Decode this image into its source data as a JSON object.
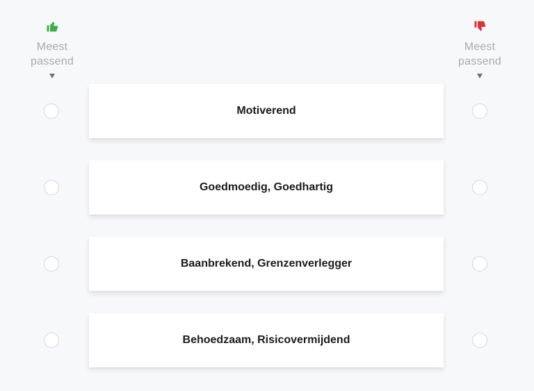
{
  "header": {
    "most_label_line1": "Meest",
    "most_label_line2": "passend",
    "least_label_line1": "Meest",
    "least_label_line2": "passend",
    "most_icon": "thumbs-up-icon",
    "least_icon": "thumbs-down-icon",
    "most_color": "#3bb04a",
    "least_color": "#d9343b"
  },
  "options": [
    {
      "label": "Motiverend",
      "most_selected": false,
      "least_selected": false
    },
    {
      "label": "Goedmoedig, Goedhartig",
      "most_selected": false,
      "least_selected": false
    },
    {
      "label": "Baanbrekend, Grenzenverlegger",
      "most_selected": false,
      "least_selected": false
    },
    {
      "label": "Behoedzaam, Risicovermijdend",
      "most_selected": false,
      "least_selected": false
    }
  ]
}
